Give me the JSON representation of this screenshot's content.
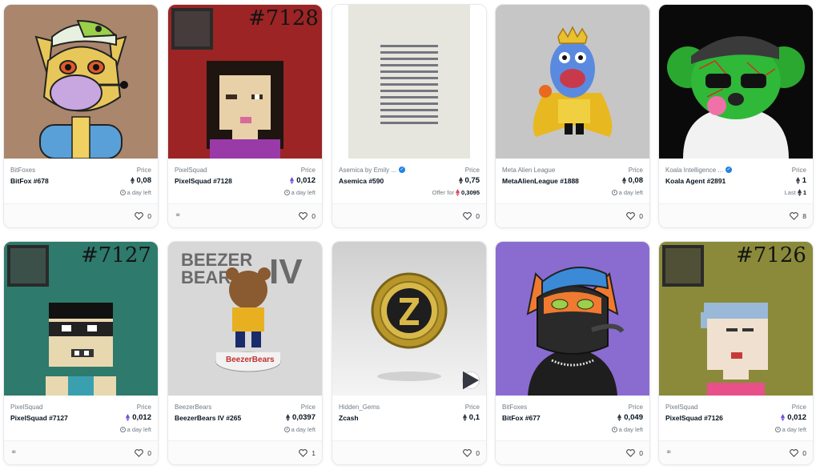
{
  "cards": [
    {
      "collection": "BitFoxes",
      "name": "BitFox #678",
      "price_label": "Price",
      "price": "0,08",
      "sub_text": "a day left",
      "sub_type": "time",
      "likes": "0",
      "link": false,
      "verified": false
    },
    {
      "collection": "PixelSquad",
      "name": "PixelSquad #7128",
      "price_label": "Price",
      "price": "0,012",
      "sub_text": "a day left",
      "sub_type": "time",
      "likes": "0",
      "link": true,
      "verified": false,
      "overlay": "#7128"
    },
    {
      "collection": "Asemica by Emily ...",
      "name": "Asemica #590",
      "price_label": "Price",
      "price": "0,75",
      "sub_text": "Offer for",
      "sub_value": "0,3095",
      "sub_type": "offer",
      "likes": "0",
      "link": false,
      "verified": true
    },
    {
      "collection": "Meta Alien League",
      "name": "MetaAlienLeague #1888",
      "price_label": "Price",
      "price": "0,08",
      "sub_text": "a day left",
      "sub_type": "time",
      "likes": "0",
      "link": false,
      "verified": false
    },
    {
      "collection": "Koala Intelligence ...",
      "name": "Koala Agent #2891",
      "price_label": "Price",
      "price": "1",
      "sub_text": "Last",
      "sub_value": "1",
      "sub_type": "last",
      "likes": "8",
      "link": false,
      "verified": true
    },
    {
      "collection": "PixelSquad",
      "name": "PixelSquad #7127",
      "price_label": "Price",
      "price": "0,012",
      "sub_text": "a day left",
      "sub_type": "time",
      "likes": "0",
      "link": true,
      "verified": false,
      "overlay": "#7127"
    },
    {
      "collection": "BeezerBears",
      "name": "BeezerBears IV #265",
      "price_label": "Price",
      "price": "0,0397",
      "sub_text": "a day left",
      "sub_type": "time",
      "likes": "1",
      "link": false,
      "verified": false,
      "art_text_1": "BEEZER",
      "art_text_2": "BEAR",
      "art_text_3": "IV",
      "art_text_4": "BeezerBears"
    },
    {
      "collection": "Hidden_Gems",
      "name": "Zcash",
      "price_label": "Price",
      "price": "0,1",
      "sub_text": "",
      "sub_type": "none",
      "likes": "0",
      "link": false,
      "verified": false
    },
    {
      "collection": "BitFoxes",
      "name": "BitFox #677",
      "price_label": "Price",
      "price": "0,049",
      "sub_text": "a day left",
      "sub_type": "time",
      "likes": "0",
      "link": false,
      "verified": false
    },
    {
      "collection": "PixelSquad",
      "name": "PixelSquad #7126",
      "price_label": "Price",
      "price": "0,012",
      "sub_text": "a day left",
      "sub_type": "time",
      "likes": "0",
      "link": true,
      "verified": false,
      "overlay": "#7126"
    }
  ],
  "icons": {
    "eth": "ethereum-icon",
    "heart": "heart-icon",
    "link": "link-icon",
    "clock": "clock-icon",
    "verified": "verified-badge-icon",
    "play": "play-icon"
  },
  "colors": {
    "accent": "#2081e2",
    "eth_purple": "#6d4fd8",
    "eth_dark": "#353840",
    "offer_red": "#e2435b"
  }
}
